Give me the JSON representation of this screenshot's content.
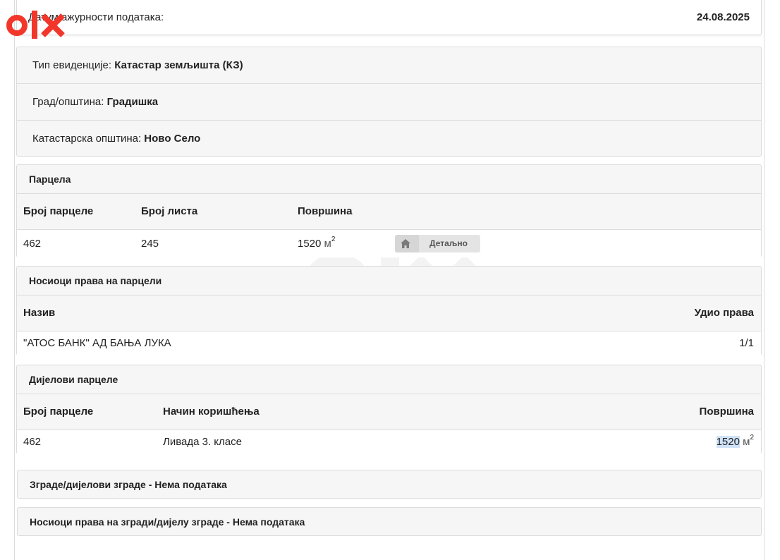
{
  "logo": {
    "text": "OLX"
  },
  "header": {
    "date_label": "Датум ажурности података:",
    "date_value": "24.08.2025"
  },
  "info": {
    "record_type_label": "Тип евиденције: ",
    "record_type_value": "Катастар земљишта (КЗ)",
    "city_label": "Град/општина: ",
    "city_value": "Градишка",
    "cadastral_label": "Катастарска општина: ",
    "cadastral_value": "Ново Село"
  },
  "parcel": {
    "title": "Парцела",
    "col_number": "Број парцеле",
    "col_sheet": "Број листа",
    "col_area": "Површина",
    "number": "462",
    "sheet": "245",
    "area": "1520",
    "unit": "м",
    "unit_sup": "2",
    "detail_button": "Детаљно",
    "detail_icon": "home-icon"
  },
  "rights_holders": {
    "title": "Носиоци права на парцели",
    "col_name": "Назив",
    "col_share": "Удио права",
    "rows": [
      {
        "name": "\"АТОС БАНК\" АД БАЊА ЛУКА",
        "share": "1/1"
      }
    ]
  },
  "parcel_parts": {
    "title": "Дијелови парцеле",
    "col_number": "Број парцеле",
    "col_usage": "Начин коришћења",
    "col_area": "Површина",
    "rows": [
      {
        "number": "462",
        "usage": "Ливада 3. класе",
        "area": "1520",
        "unit": "м",
        "unit_sup": "2"
      }
    ]
  },
  "buildings": {
    "title": "Зграде/дијелови зграде - Нема података"
  },
  "building_rights": {
    "title": "Носиоци права на згради/дијелу зграде - Нема података"
  },
  "colors": {
    "logo": "#f2372a",
    "card_bg": "#f6f6f7",
    "border": "#dcdcdc",
    "highlight": "#cfe2f7"
  }
}
